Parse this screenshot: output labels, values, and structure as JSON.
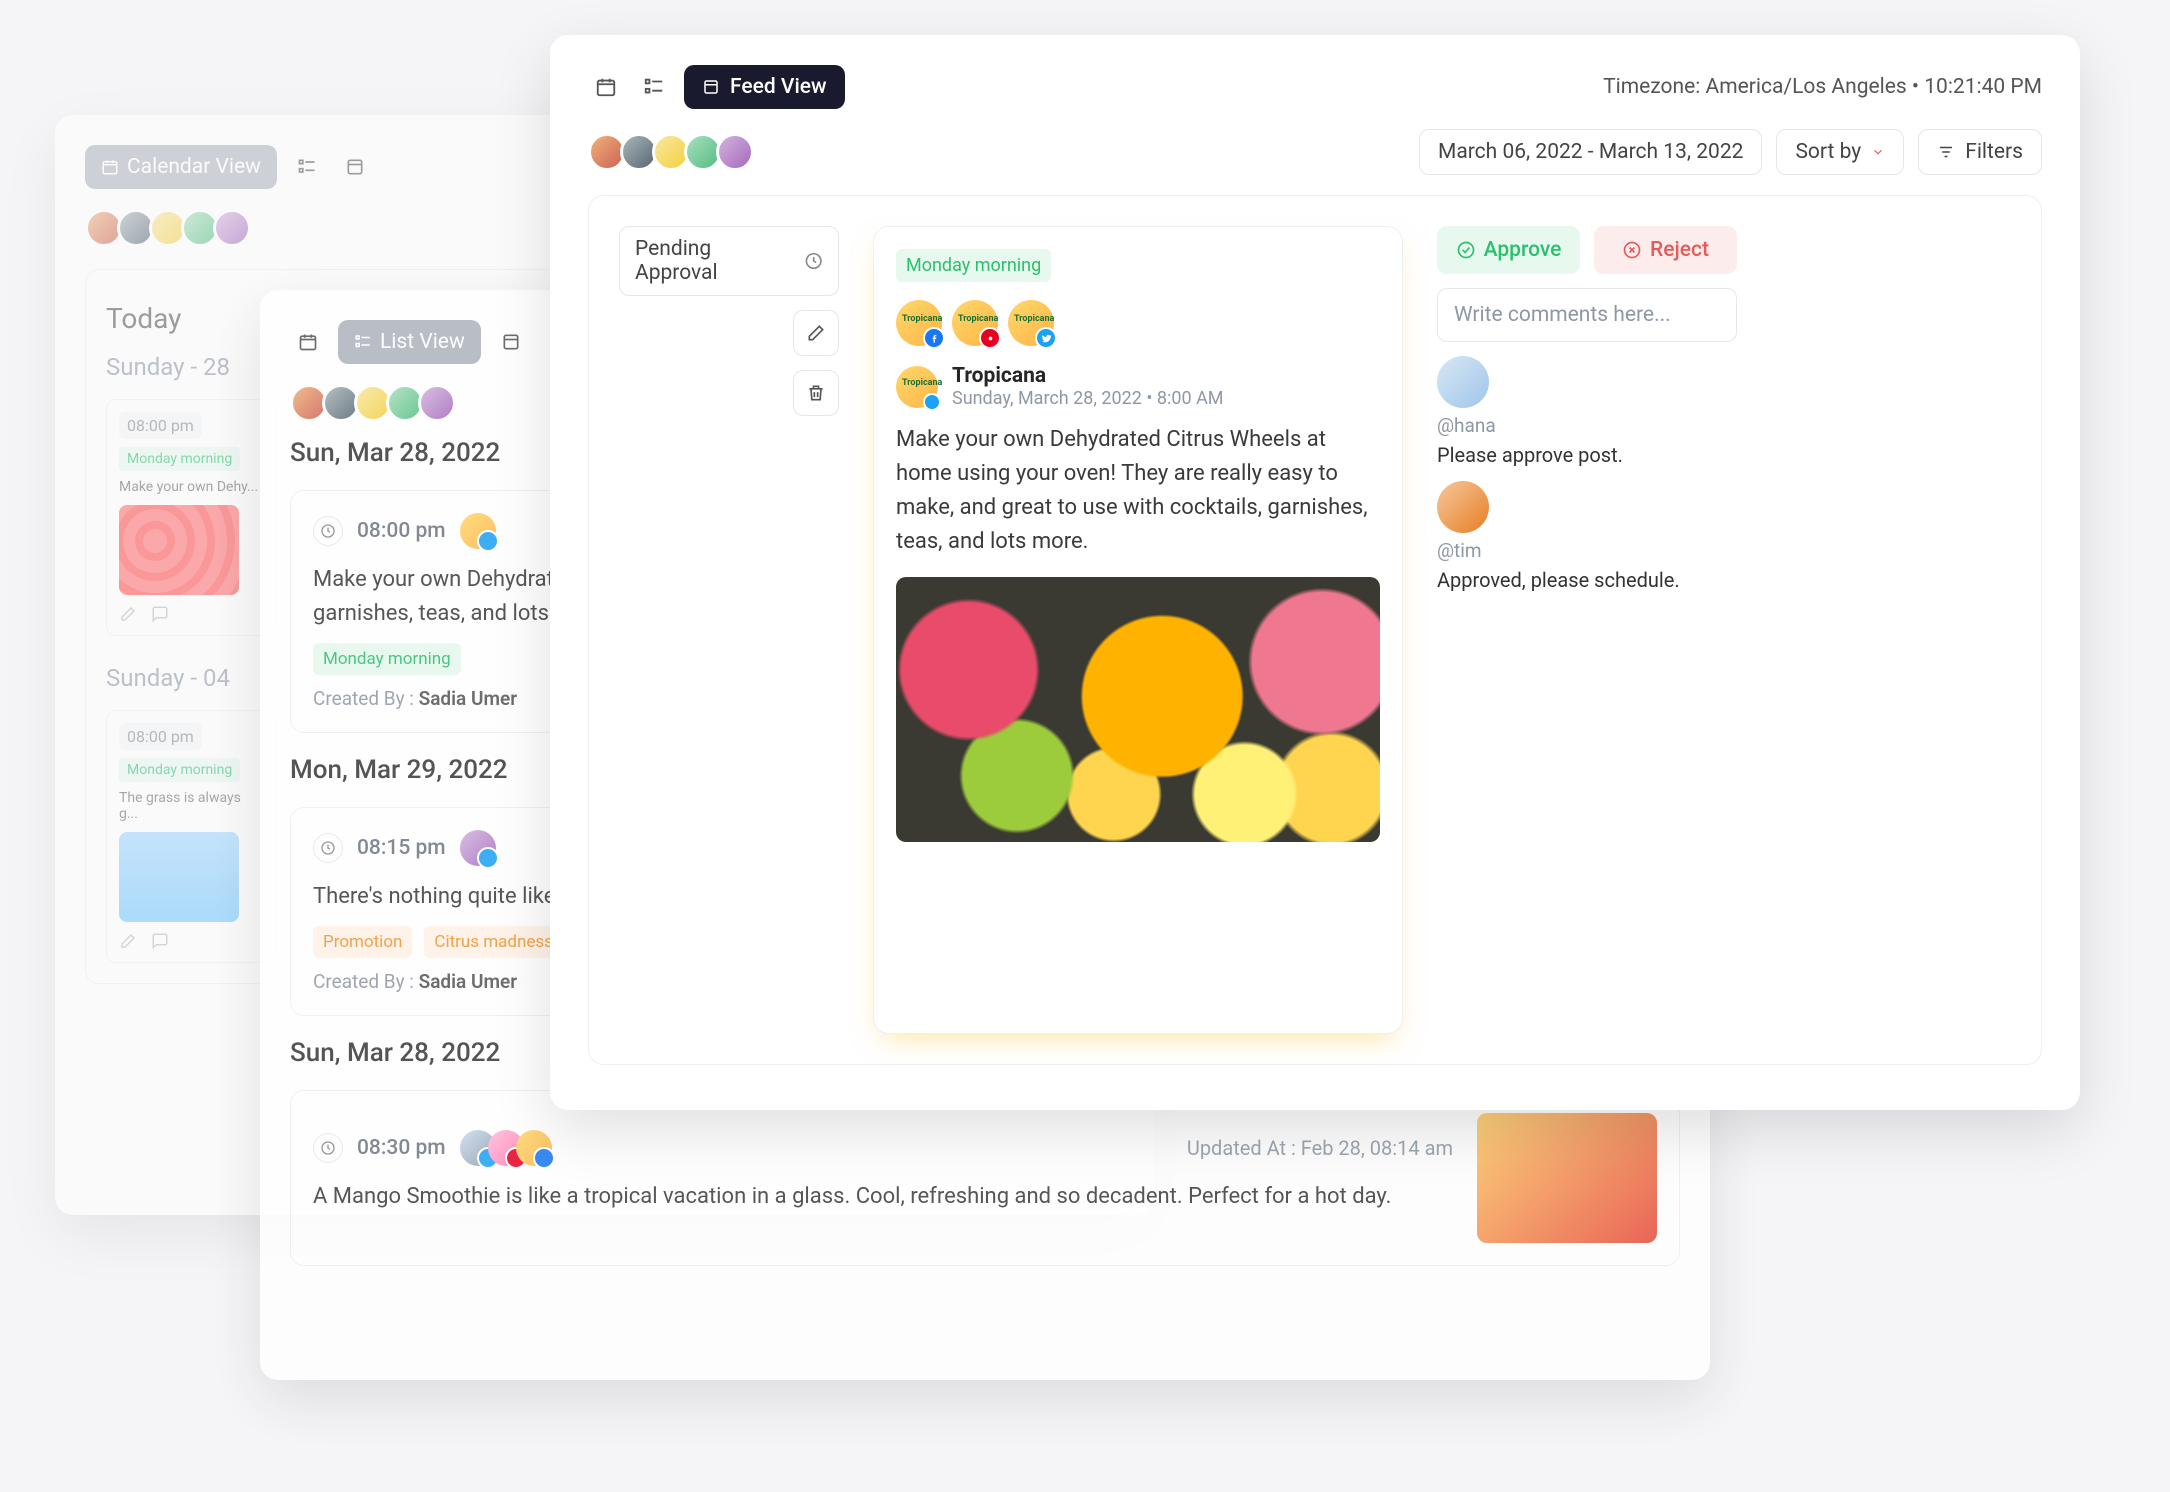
{
  "back": {
    "view_label": "Calendar View",
    "today": "Today",
    "days": [
      {
        "title": "Sunday - 28",
        "time": "08:00 pm",
        "tag": "Monday morning",
        "text": "Make your own Dehy..."
      },
      {
        "title": "Sunday - 04",
        "time": "08:00 pm",
        "tag": "Monday morning",
        "text": "The grass is always g..."
      }
    ]
  },
  "mid": {
    "view_label": "List View",
    "groups": [
      {
        "day": "Sun, Mar 28, 2022",
        "items": [
          {
            "time": "08:00 pm",
            "text": "Make your own Dehydrated Citrus Wheels at home using your oven! They are really easy to make, and great to use with cocktails, garnishes, teas, and lots more.",
            "tag_mint": "Monday morning",
            "by": "Sadia Umer"
          }
        ]
      },
      {
        "day": "Mon, Mar 29, 2022",
        "items": [
          {
            "time": "08:15 pm",
            "text": "There's nothing quite like a chilled glass of fresh, homemade watermelon juice recipe is easy and made with just a few ingredients.",
            "tag1": "Promotion",
            "tag2": "Citrus madness",
            "by": "Sadia Umer"
          }
        ]
      },
      {
        "day": "Sun, Mar 28, 2022",
        "items": [
          {
            "time": "08:30 pm",
            "text": "A Mango Smoothie is like a tropical vacation in a glass. Cool, refreshing and so decadent. Perfect for a hot day.",
            "updated": "Updated At : Feb 28, 08:14 am"
          }
        ]
      }
    ]
  },
  "front": {
    "view_label": "Feed View",
    "tz": "Timezone: America/Los Angeles • 10:21:40 PM",
    "daterange": "March 06, 2022 - March 13, 2022",
    "sort": "Sort by",
    "filters": "Filters",
    "pending": "Pending Approval",
    "post": {
      "tag": "Monday morning",
      "author": "Tropicana",
      "meta": "Sunday, March 28, 2022 • 8:00 AM",
      "body": "Make your own Dehydrated Citrus Wheels at home using your oven! They are really easy to make, and great to use with cocktails, garnishes, teas, and lots more."
    },
    "approve": "Approve",
    "reject": "Reject",
    "comment_ph": "Write comments here...",
    "comments": [
      {
        "handle": "@hana",
        "text": "Please approve post."
      },
      {
        "handle": "@tim",
        "text": "Approved, please schedule."
      }
    ]
  }
}
